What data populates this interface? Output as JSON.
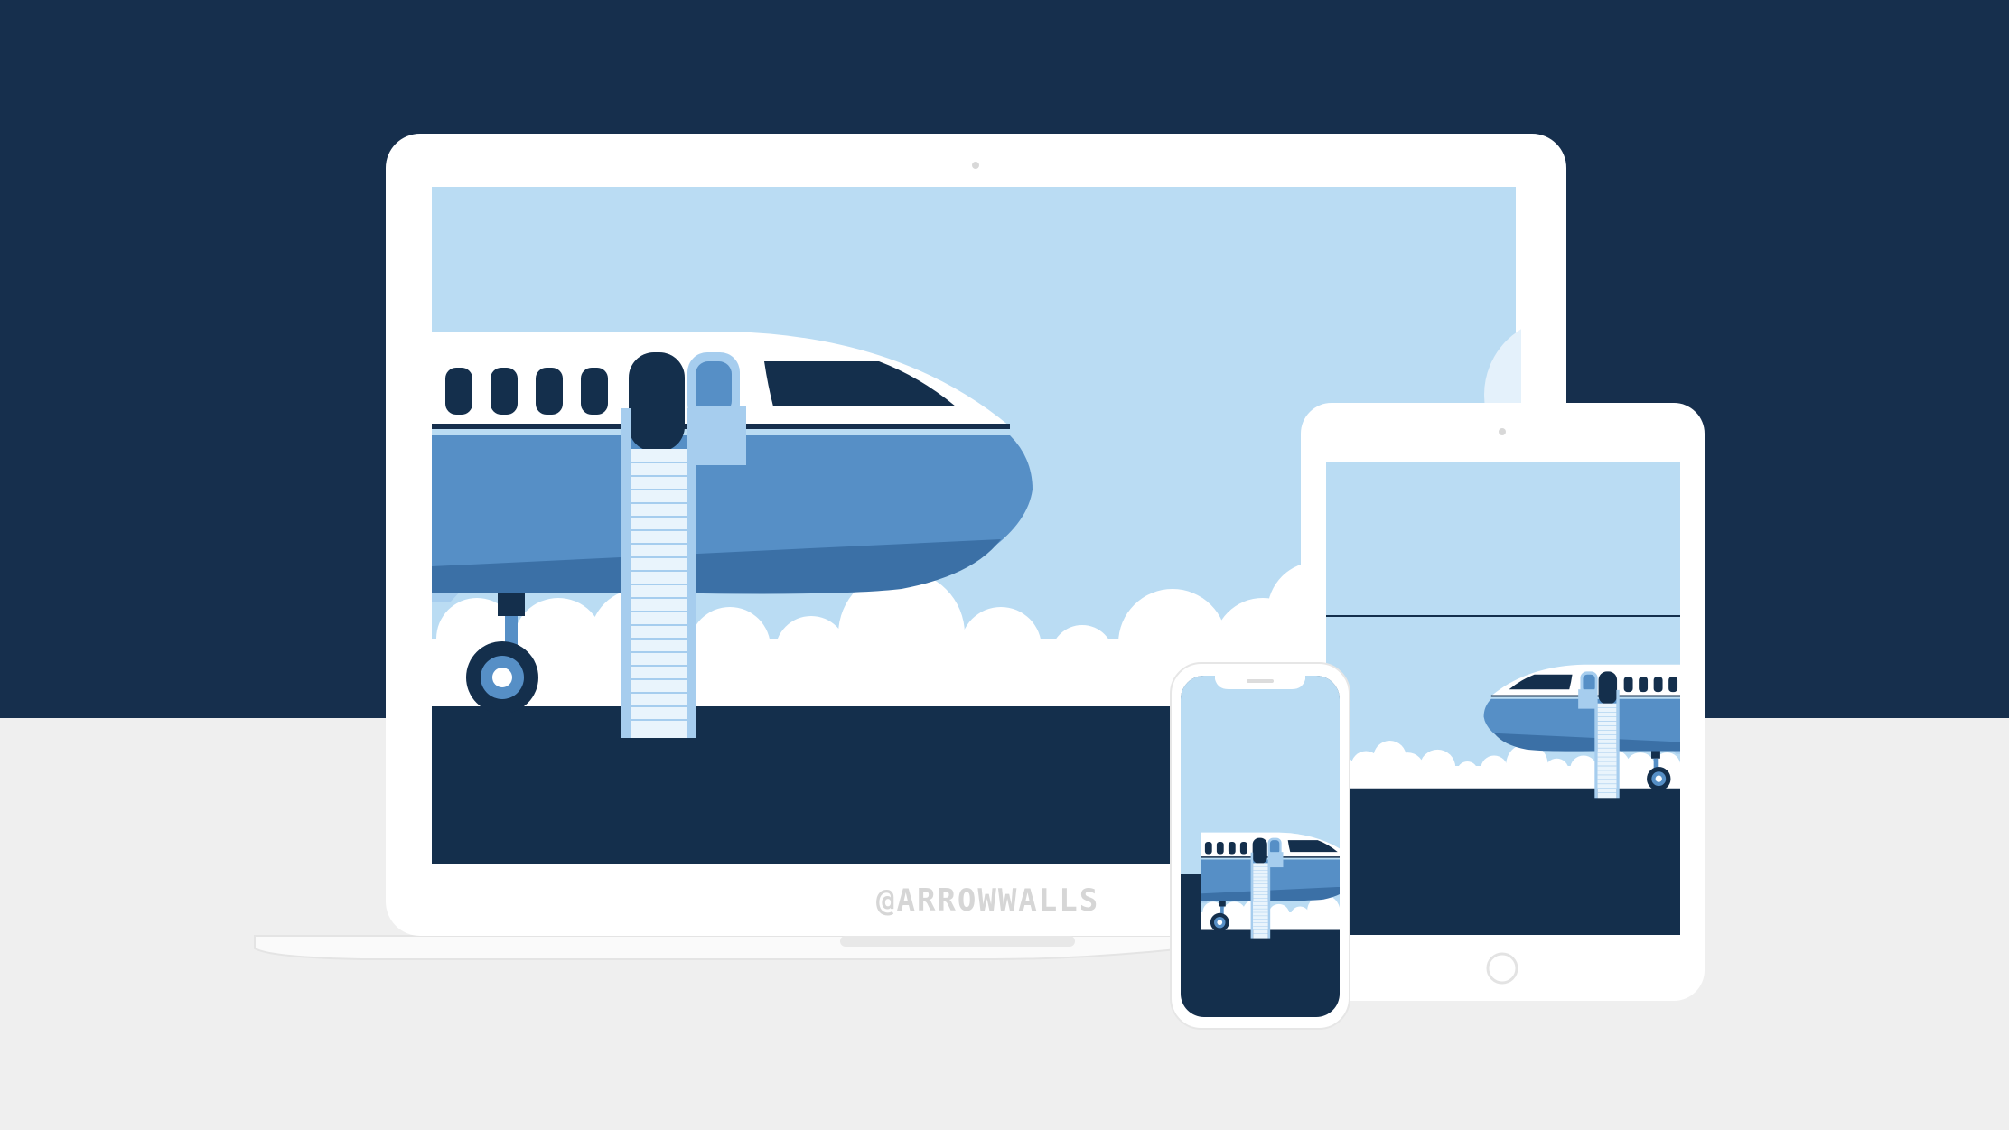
{
  "colors": {
    "background_top": "#162f4d",
    "background_bottom": "#efefef",
    "device_frame": "#ffffff",
    "sky": "#badcf3",
    "ground": "#142f4c",
    "fuselage_upper": "#ffffff",
    "fuselage_stripe": "#568fc6",
    "fuselage_belly": "#3b70a6",
    "window": "#142f4c",
    "door_open": "#7eb0df",
    "stairs": "#e9f4fc",
    "cloud": "#ffffff",
    "watermark": "#d6d6d6"
  },
  "devices": [
    "laptop",
    "tablet",
    "phone"
  ],
  "watermark": {
    "text": "@ARROWWALLS"
  }
}
